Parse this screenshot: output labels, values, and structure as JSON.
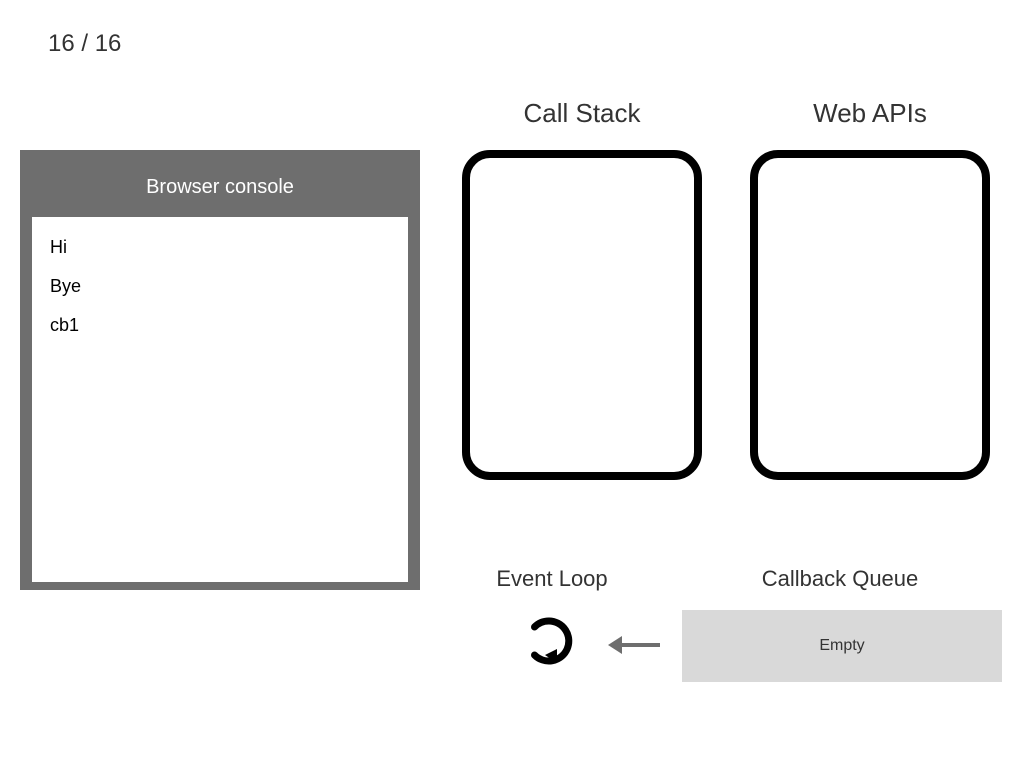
{
  "step": {
    "current": 16,
    "total": 16,
    "display": "16 / 16"
  },
  "console": {
    "title": "Browser console",
    "lines": [
      "Hi",
      "Bye",
      "cb1"
    ]
  },
  "labels": {
    "callstack": "Call Stack",
    "webapis": "Web APIs",
    "eventloop": "Event Loop",
    "callbackqueue": "Callback Queue"
  },
  "callstack": {
    "items": []
  },
  "webapis": {
    "items": []
  },
  "callback_queue": {
    "status": "Empty",
    "items": []
  }
}
